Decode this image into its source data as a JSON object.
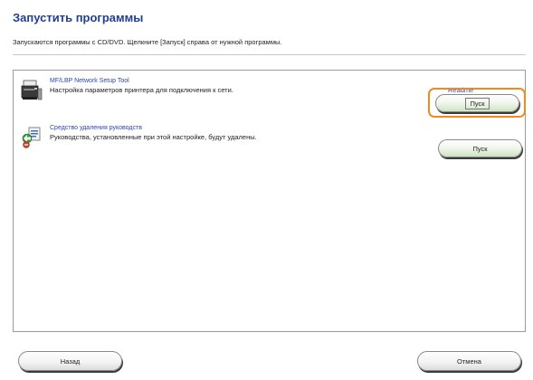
{
  "header": {
    "title": "Запустить программы",
    "subtitle": "Запускаются программы с CD/DVD. Щелкните [Запуск] справа от нужной программы."
  },
  "programs": [
    {
      "name": "MF/LBP Network Setup Tool",
      "description": "Настройка параметров принтера для подключения к сети.",
      "readme_label": "Readme",
      "button_label": "Пуск",
      "icon": "printer-icon"
    },
    {
      "name": "Средство удаления руководств",
      "description": "Руководства, установленные при этой настройке, будут удалены.",
      "button_label": "Пуск",
      "icon": "uninstall-icon"
    }
  ],
  "footer": {
    "back_label": "Назад",
    "cancel_label": "Отмена"
  },
  "colors": {
    "title": "#1f3f8f",
    "link": "#2a46b4",
    "highlight": "#f08a1c"
  }
}
